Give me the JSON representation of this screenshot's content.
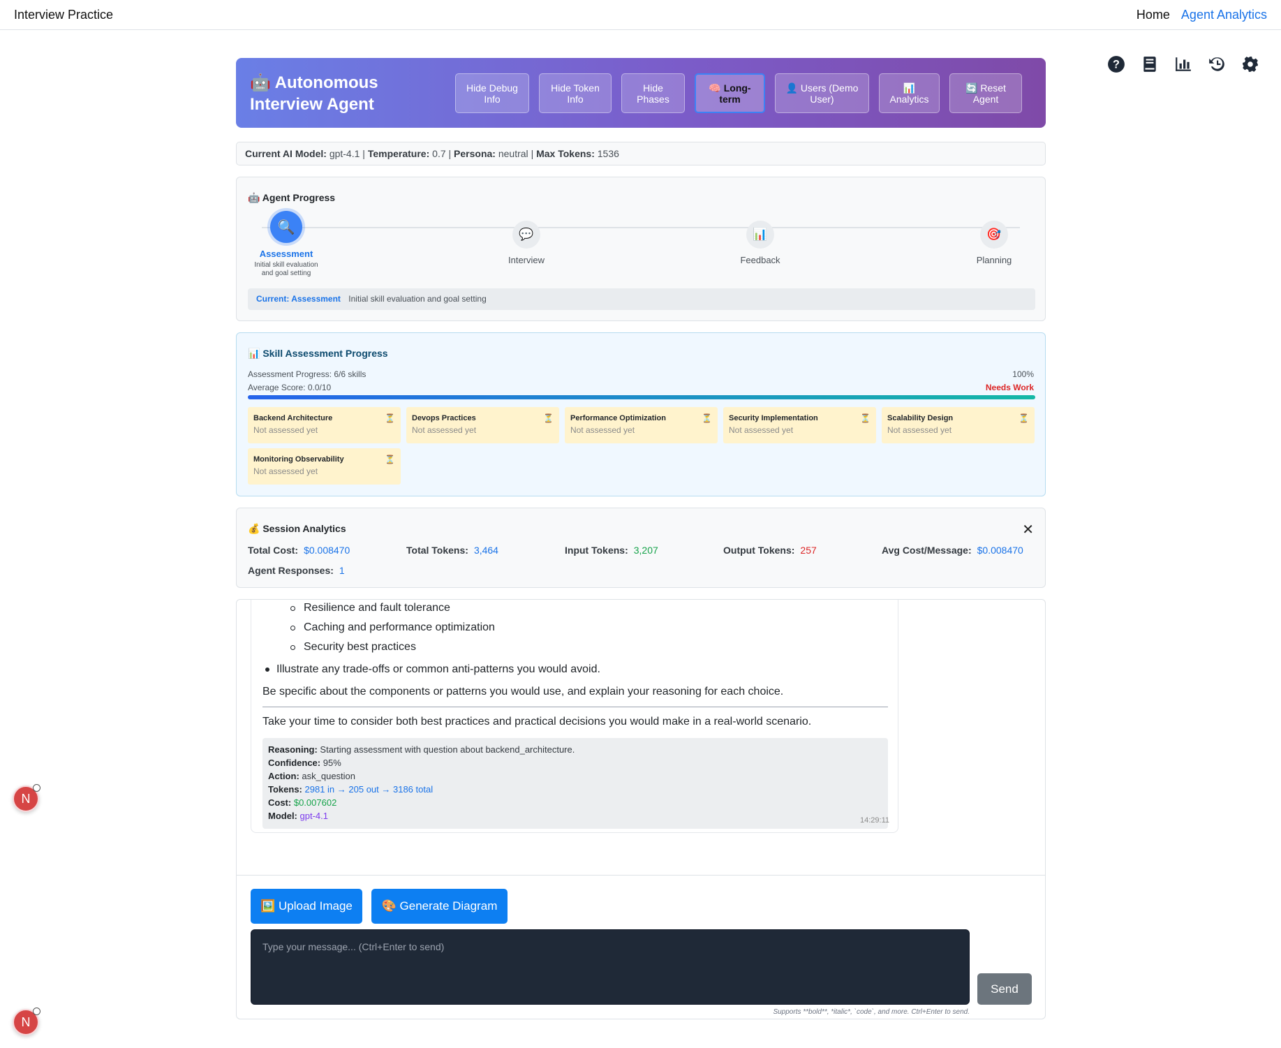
{
  "nav": {
    "brand": "Interview Practice",
    "home": "Home",
    "agent_analytics": "Agent Analytics"
  },
  "right_icons": [
    "help-icon",
    "book-icon",
    "chart-icon",
    "history-icon",
    "gear-icon"
  ],
  "header": {
    "title": "🤖 Autonomous Interview Agent",
    "buttons": {
      "debug": "Hide Debug Info",
      "token": "Hide Token Info",
      "phases": "Hide Phases",
      "longterm": "🧠 Long-term",
      "users": "👤 Users (Demo User)",
      "analytics": "📊 Analytics",
      "reset": "🔄 Reset Agent"
    }
  },
  "model_bar": {
    "model_label": "Current AI Model:",
    "model": "gpt-4.1",
    "temp_label": "Temperature:",
    "temp": "0.7",
    "persona_label": "Persona:",
    "persona": "neutral",
    "tokens_label": "Max Tokens:",
    "tokens": "1536",
    "sep": "|"
  },
  "progress": {
    "title": "🤖 Agent Progress",
    "phases": [
      {
        "icon": "🔍",
        "name": "Assessment",
        "desc": "Initial skill evaluation and goal setting"
      },
      {
        "icon": "💬",
        "name": "Interview"
      },
      {
        "icon": "📊",
        "name": "Feedback"
      },
      {
        "icon": "🎯",
        "name": "Planning"
      }
    ],
    "current_label": "Current: Assessment",
    "current_desc": "Initial skill evaluation and goal setting"
  },
  "skills": {
    "title": "📊 Skill Assessment Progress",
    "progress_text": "Assessment Progress: 6/6 skills",
    "percent": "100%",
    "avg_score": "Average Score: 0.0/10",
    "status": "Needs Work",
    "progress_fraction": 1.0,
    "items": [
      {
        "name": "Backend Architecture",
        "status": "Not assessed yet"
      },
      {
        "name": "Devops Practices",
        "status": "Not assessed yet"
      },
      {
        "name": "Performance Optimization",
        "status": "Not assessed yet"
      },
      {
        "name": "Security Implementation",
        "status": "Not assessed yet"
      },
      {
        "name": "Scalability Design",
        "status": "Not assessed yet"
      },
      {
        "name": "Monitoring Observability",
        "status": "Not assessed yet"
      }
    ],
    "pending_icon": "⏳"
  },
  "analytics": {
    "title": "💰 Session Analytics",
    "close": "✕",
    "total_cost_label": "Total Cost:",
    "total_cost": "$0.008470",
    "total_tokens_label": "Total Tokens:",
    "total_tokens": "3,464",
    "input_tokens_label": "Input Tokens:",
    "input_tokens": "3,207",
    "output_tokens_label": "Output Tokens:",
    "output_tokens": "257",
    "avg_cost_label": "Avg Cost/Message:",
    "avg_cost": "$0.008470",
    "agent_responses_label": "Agent Responses:",
    "agent_responses": "1"
  },
  "chat": {
    "sub_items": [
      "Resilience and fault tolerance",
      "Caching and performance optimization",
      "Security best practices"
    ],
    "bullet": "Illustrate any trade-offs or common anti-patterns you would avoid.",
    "para1": "Be specific about the components or patterns you would use, and explain your reasoning for each choice.",
    "para2": "Take your time to consider both best practices and practical decisions you would make in a real-world scenario.",
    "debug": {
      "reasoning_label": "Reasoning:",
      "reasoning": "Starting assessment with question about backend_architecture.",
      "confidence_label": "Confidence:",
      "confidence": "95%",
      "action_label": "Action:",
      "action": "ask_question",
      "tokens_label": "Tokens:",
      "tokens": "2981 in → 205 out → 3186 total",
      "cost_label": "Cost:",
      "cost": "$0.007602",
      "model_label": "Model:",
      "model": "gpt-4.1"
    },
    "timestamp": "14:29:11",
    "upload": "🖼️ Upload Image",
    "diagram": "🎨 Generate Diagram",
    "placeholder": "Type your message... (Ctrl+Enter to send)",
    "send": "Send",
    "hint": "Supports **bold**, *italic*, `code`, and more. Ctrl+Enter to send."
  },
  "floating": {
    "letter": "N"
  },
  "colors": {
    "accent": "#1a73e8",
    "header_start": "#6a7fe6",
    "header_end": "#7f4aa8",
    "needs_work": "#dc2626"
  }
}
